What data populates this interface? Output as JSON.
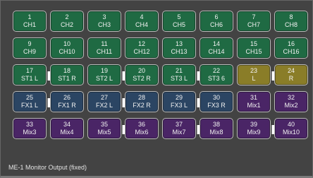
{
  "footer": {
    "label": "ME-1 Monitor Output (fixed)"
  },
  "colors": {
    "channel": "#1f6a43",
    "stereo": "#1f6a43",
    "aux": "#8a7d28",
    "fx": "#2b4563",
    "mix": "#4a2566",
    "link": "#ffffff"
  },
  "buttons": [
    {
      "number": "1",
      "label": "CH1",
      "group": "channel"
    },
    {
      "number": "2",
      "label": "CH2",
      "group": "channel"
    },
    {
      "number": "3",
      "label": "CH3",
      "group": "channel"
    },
    {
      "number": "4",
      "label": "CH4",
      "group": "channel"
    },
    {
      "number": "5",
      "label": "CH5",
      "group": "channel"
    },
    {
      "number": "6",
      "label": "CH6",
      "group": "channel"
    },
    {
      "number": "7",
      "label": "CH7",
      "group": "channel"
    },
    {
      "number": "8",
      "label": "CH8",
      "group": "channel"
    },
    {
      "number": "9",
      "label": "CH9",
      "group": "channel"
    },
    {
      "number": "10",
      "label": "CH10",
      "group": "channel"
    },
    {
      "number": "11",
      "label": "CH11",
      "group": "channel"
    },
    {
      "number": "12",
      "label": "CH12",
      "group": "channel"
    },
    {
      "number": "13",
      "label": "CH13",
      "group": "channel"
    },
    {
      "number": "14",
      "label": "CH14",
      "group": "channel"
    },
    {
      "number": "15",
      "label": "CH15",
      "group": "channel"
    },
    {
      "number": "16",
      "label": "CH16",
      "group": "channel"
    },
    {
      "number": "17",
      "label": "ST1 L",
      "group": "stereo",
      "link_right": true
    },
    {
      "number": "18",
      "label": "ST1 R",
      "group": "stereo"
    },
    {
      "number": "19",
      "label": "ST2 L",
      "group": "stereo",
      "link_right": true
    },
    {
      "number": "20",
      "label": "ST2 R",
      "group": "stereo"
    },
    {
      "number": "21",
      "label": "ST3 L",
      "group": "stereo",
      "link_right": true
    },
    {
      "number": "22",
      "label": "ST3 6",
      "group": "stereo"
    },
    {
      "number": "23",
      "label": "L",
      "group": "aux",
      "link_right": true
    },
    {
      "number": "24",
      "label": "R",
      "group": "aux"
    },
    {
      "number": "25",
      "label": "FX1 L",
      "group": "fx",
      "link_right": true
    },
    {
      "number": "26",
      "label": "FX1 R",
      "group": "fx"
    },
    {
      "number": "27",
      "label": "FX2 L",
      "group": "fx",
      "link_right": true
    },
    {
      "number": "28",
      "label": "FX2 R",
      "group": "fx"
    },
    {
      "number": "29",
      "label": "FX3 L",
      "group": "fx",
      "link_right": true
    },
    {
      "number": "30",
      "label": "FX3 R",
      "group": "fx"
    },
    {
      "number": "31",
      "label": "Mix1",
      "group": "mix"
    },
    {
      "number": "32",
      "label": "Mix2",
      "group": "mix"
    },
    {
      "number": "33",
      "label": "Mix3",
      "group": "mix"
    },
    {
      "number": "34",
      "label": "Mix4",
      "group": "mix"
    },
    {
      "number": "35",
      "label": "Mix5",
      "group": "mix",
      "link_right": true
    },
    {
      "number": "36",
      "label": "Mix6",
      "group": "mix"
    },
    {
      "number": "37",
      "label": "Mix7",
      "group": "mix",
      "link_right": true
    },
    {
      "number": "38",
      "label": "Mix8",
      "group": "mix"
    },
    {
      "number": "39",
      "label": "Mix9",
      "group": "mix",
      "link_right": true
    },
    {
      "number": "40",
      "label": "Mix10",
      "group": "mix"
    }
  ]
}
